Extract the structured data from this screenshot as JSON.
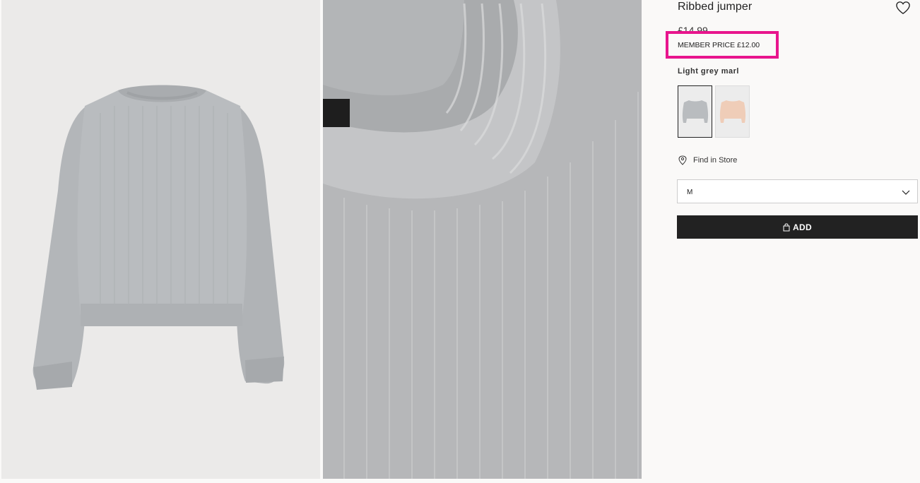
{
  "product": {
    "title": "Ribbed jumper",
    "price": "£14.99",
    "member_price": "MEMBER PRICE £12.00",
    "colour_name": "Light grey marl",
    "swatches": [
      {
        "colour": "#b9bcbf",
        "selected": true
      },
      {
        "colour": "#efcdb8",
        "selected": false
      }
    ]
  },
  "find_in_store": {
    "label": "Find in Store",
    "icon": "location-pin-icon"
  },
  "size_select": {
    "value": "M",
    "icon": "chevron-down-icon"
  },
  "add_button": {
    "label": "ADD",
    "icon": "shopping-bag-icon"
  },
  "favourite": {
    "icon": "heart-icon"
  },
  "highlight": {
    "colour": "#e8158d"
  }
}
